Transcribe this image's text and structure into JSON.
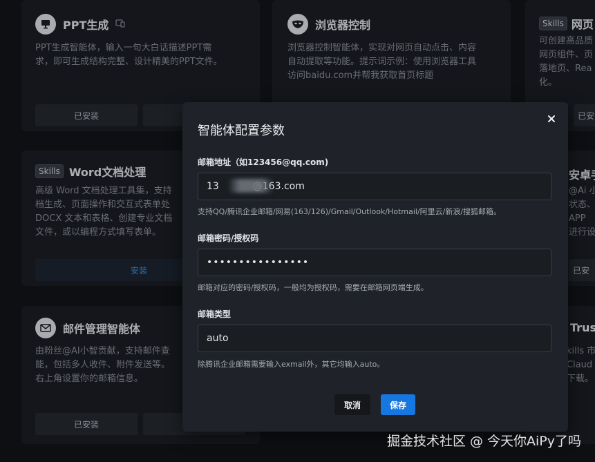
{
  "cards": {
    "ppt": {
      "title": "PPT生成",
      "desc": "PPT生成智能体，输入一句大白话描述PPT需\n求，即可生成结构完整、设计精美的PPT文件。",
      "btn_left": "已安装",
      "btn_right": ""
    },
    "browser": {
      "title": "浏览器控制",
      "desc": "浏览器控制智能体，实现对网页自动点击、内容\n自动提取等功能。提示词示例：使用浏览器工具\n访问baidu.com并帮我获取首页标题"
    },
    "web": {
      "badge": "Skills",
      "title": "网页",
      "desc": "可创建高品质\n网页组件、页\n落地页、Rea\n化。",
      "btn": "已安"
    },
    "word": {
      "badge": "Skills",
      "title": "Word文档处理",
      "desc": "高级 Word 文档处理工具集，支持\n档生成、页面操作和交互式表单处\nDOCX 文本和表格、创建专业文档\n文件，或以编程方式填写表单。",
      "btn": "安装"
    },
    "android": {
      "title": "安卓手",
      "desc": "@Ai 小\n状态、\nAPP\n进行设",
      "btn": "已安"
    },
    "email": {
      "title": "邮件管理智能体",
      "desc": "由粉丝@AI小智贡献，支持邮件查\n能，包括多人收件、附件发送等。\n右上角设置你的邮箱信息。",
      "btn_left": "已安装",
      "btn_right": ""
    },
    "trust": {
      "title": "Trust",
      "desc": "kills 市\nClaud\n下载。"
    }
  },
  "modal": {
    "title": "智能体配置参数",
    "email_label": "邮箱地址（如123456@qq.com)",
    "email_value": "13           @163.com",
    "email_hint": "支持QQ/腾讯企业邮箱/网易(163/126)/Gmail/Outlook/Hotmail/阿里云/新浪/搜狐邮箱。",
    "password_label": "邮箱密码/授权码",
    "password_value": "••••••••••••••••",
    "password_hint": "邮箱对应的密码/授权码，一般均为授权码，需要在邮箱网页端生成。",
    "type_label": "邮箱类型",
    "type_value": "auto",
    "type_hint": "除腾讯企业邮箱需要输入exmail外，其它均输入auto。",
    "cancel": "取消",
    "save": "保存"
  },
  "watermark": "掘金技术社区 @ 今天你AiPy了吗",
  "colors": {
    "background": "#121418",
    "card": "#1b1e24",
    "modal": "#1f2329",
    "primary": "#1677e0",
    "install_text": "#3d8fe8"
  }
}
